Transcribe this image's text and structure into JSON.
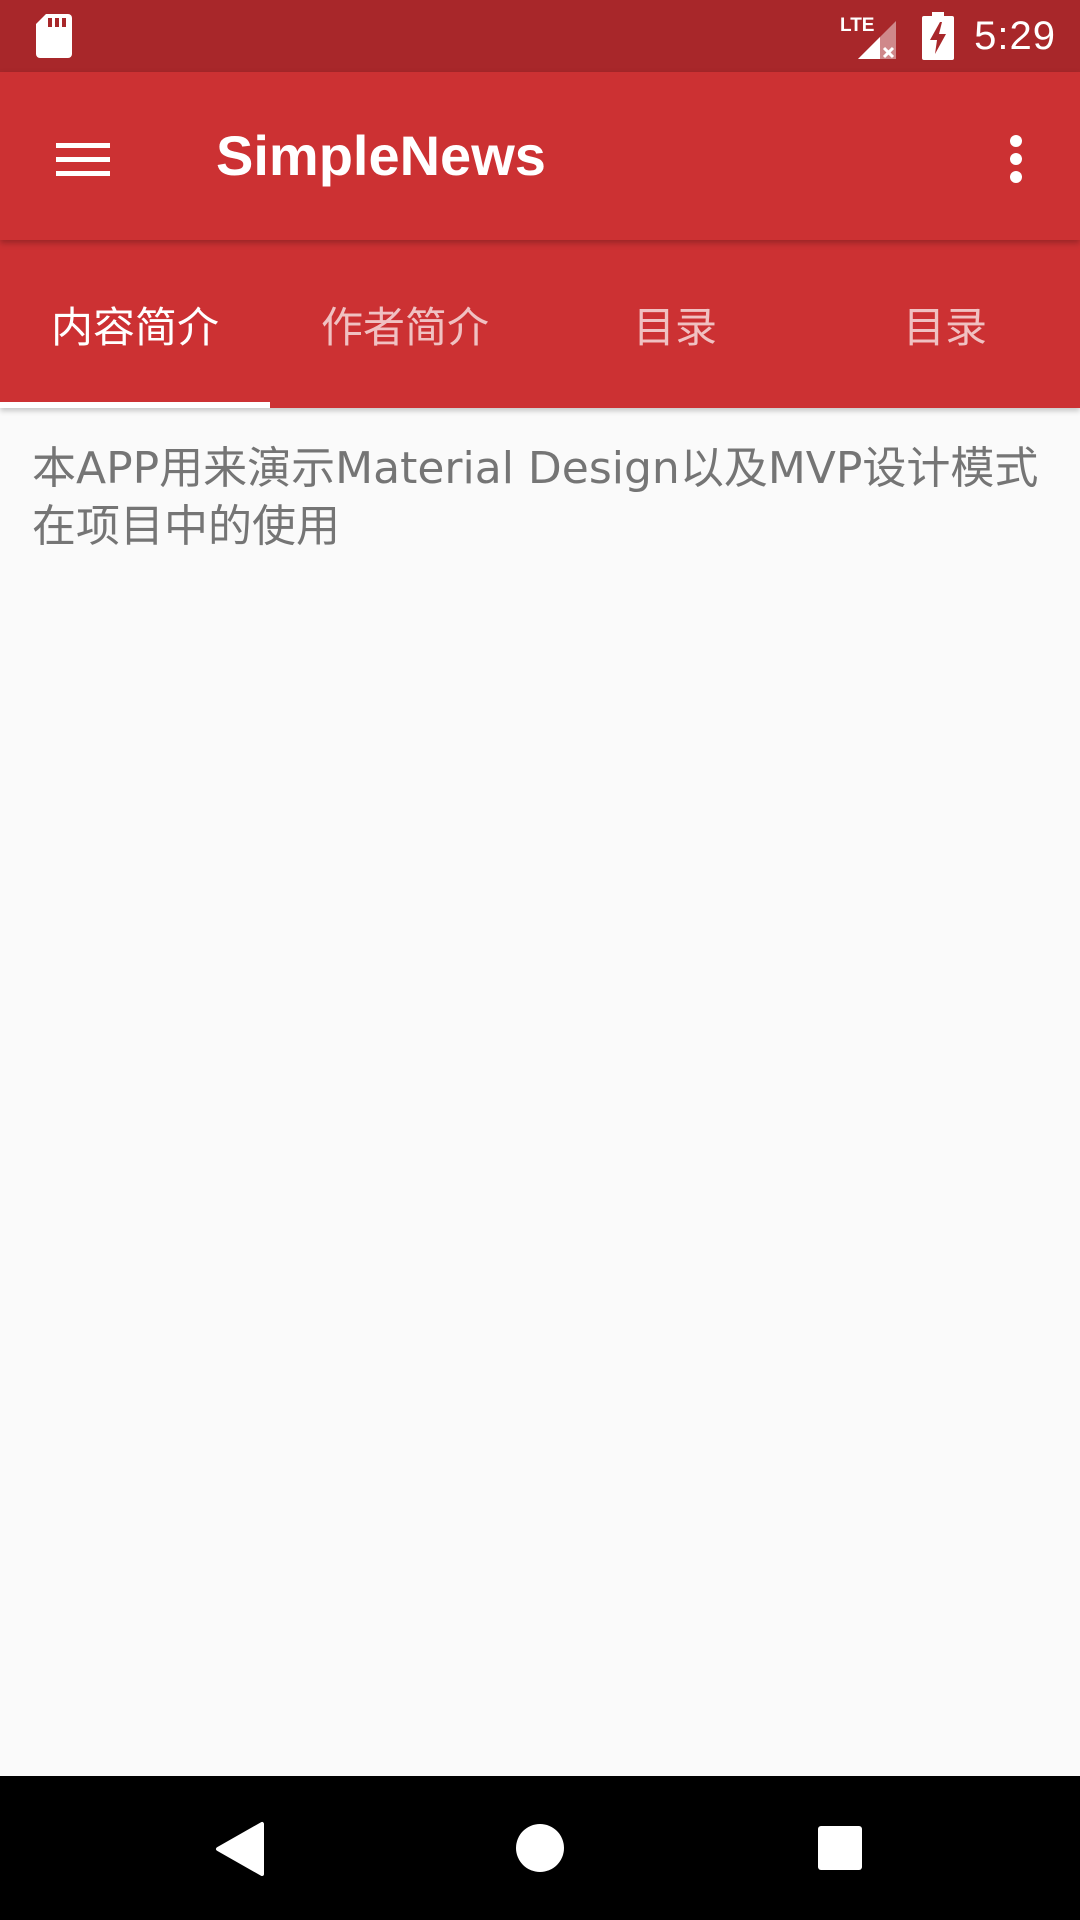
{
  "status_bar": {
    "time": "5:29",
    "network_label": "LTE",
    "icons": [
      "sd-card-icon",
      "lte-signal-icon",
      "battery-charging-icon"
    ]
  },
  "app_bar": {
    "title": "SimpleNews",
    "menu_icon": "hamburger-menu-icon",
    "overflow_icon": "more-vertical-icon"
  },
  "tabs": [
    {
      "label": "内容简介",
      "selected": true
    },
    {
      "label": "作者简介",
      "selected": false
    },
    {
      "label": "目录",
      "selected": false
    },
    {
      "label": "目录",
      "selected": false
    }
  ],
  "content": {
    "text": "本APP用来演示Material Design以及MVP设计模式在项目中的使用"
  },
  "nav_bar": {
    "icons": [
      "back-icon",
      "home-icon",
      "recents-icon"
    ]
  },
  "colors": {
    "status_bar": "#a8272a",
    "primary": "#cc3133",
    "background": "#fafafa",
    "body_text": "#757575"
  }
}
